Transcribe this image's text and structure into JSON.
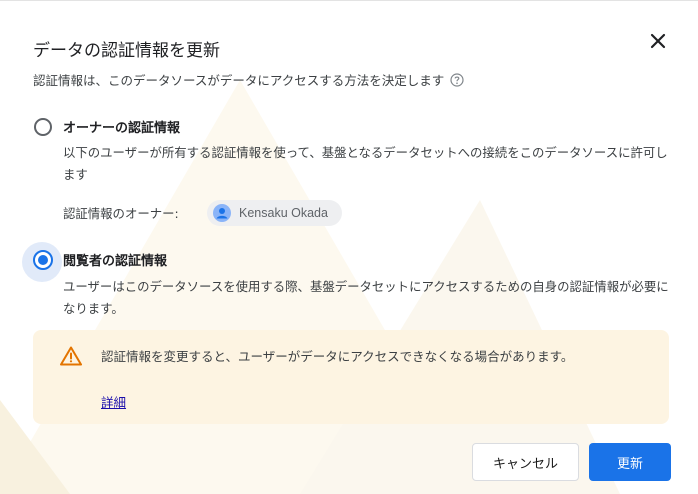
{
  "dialog": {
    "title": "データの認証情報を更新",
    "subtitle": "認証情報は、このデータソースがデータにアクセスする方法を決定します",
    "close_icon": "close-icon",
    "help_icon": "help-circle-icon"
  },
  "owner_option": {
    "label": "オーナーの認証情報",
    "description": "以下のユーザーが所有する認証情報を使って、基盤となるデータセットへの接続をこのデータソースに許可します",
    "owner_label": "認証情報のオーナー:",
    "owner_name": "Kensaku Okada",
    "selected": false
  },
  "viewer_option": {
    "label": "閲覧者の認証情報",
    "description": "ユーザーはこのデータソースを使用する際、基盤データセットにアクセスするための自身の認証情報が必要になります。",
    "selected": true
  },
  "warning": {
    "text": "認証情報を変更すると、ユーザーがデータにアクセスできなくなる場合があります。",
    "link": "詳細",
    "icon": "warning-triangle-icon"
  },
  "buttons": {
    "cancel": "キャンセル",
    "update": "更新"
  },
  "colors": {
    "accent": "#1a73e8",
    "warning_bg": "#fdf4e2",
    "warning_icon": "#e37400",
    "chip_bg": "#eeeff1"
  }
}
